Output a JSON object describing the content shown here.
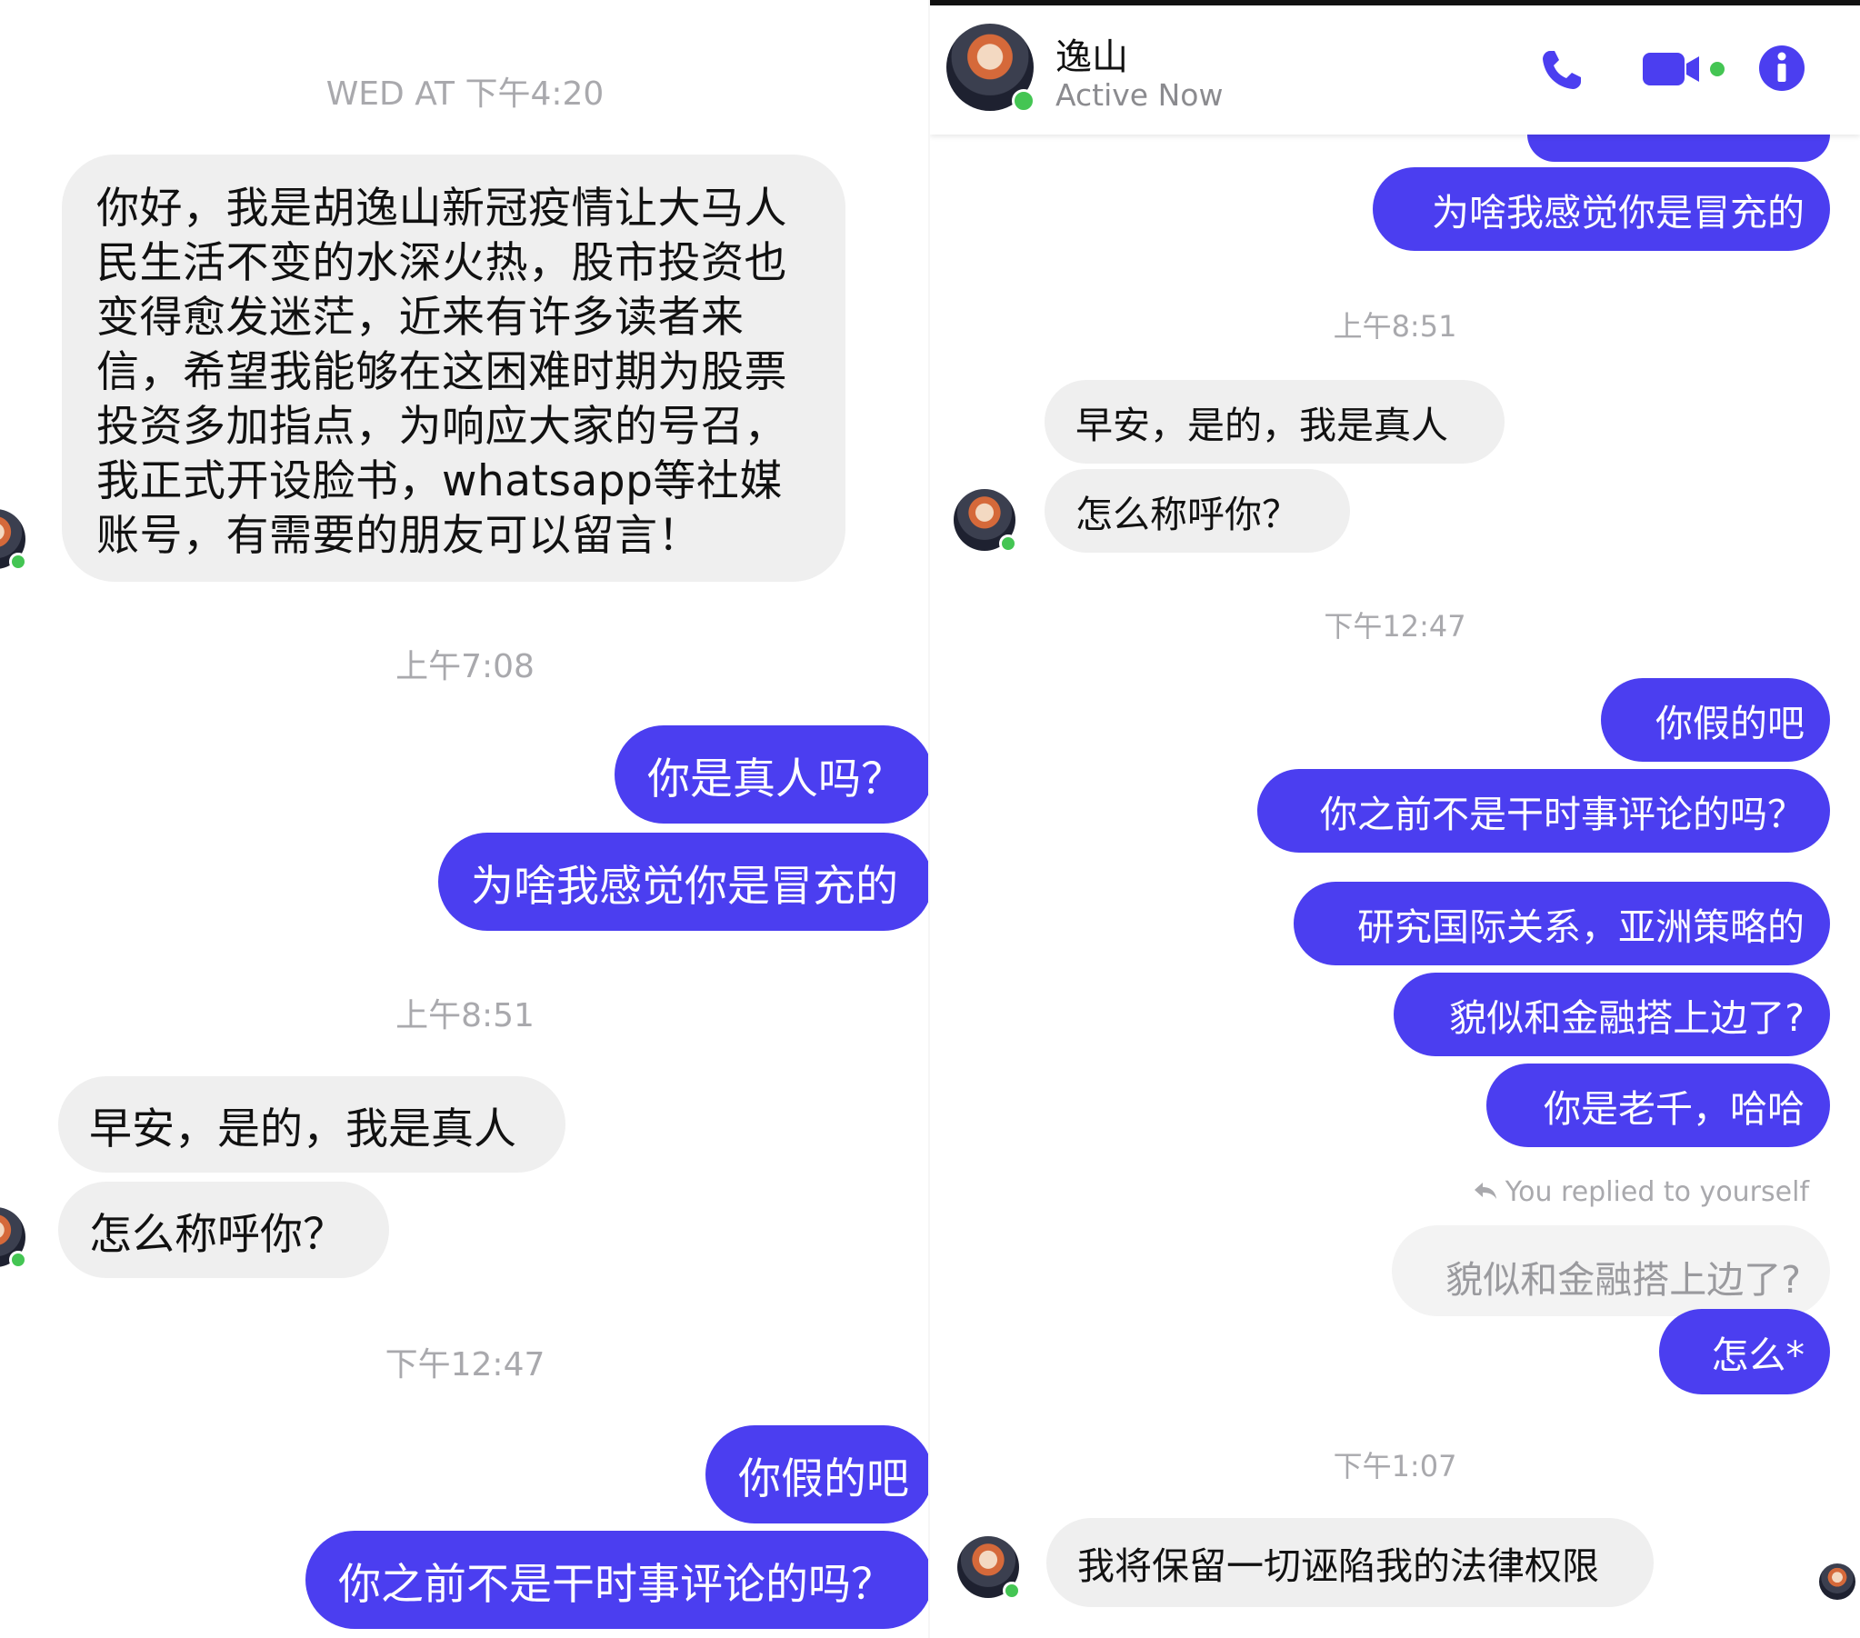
{
  "left": {
    "timestamps": {
      "t1": "WED AT 下午4:20",
      "t2": "上午7:08",
      "t3": "上午8:51",
      "t4": "下午12:47"
    },
    "messages": {
      "intro_lines": [
        "你好，我是胡逸山新冠疫情让大马人",
        "民生活不变的水深火热，股市投资也",
        "变得愈发迷茫，近来有许多读者来",
        "信，希望我能够在这困难时期为股票",
        "投资多加指点，为响应大家的号召，",
        "我正式开设脸书，whatsapp等社媒",
        "账号，有需要的朋友可以留言！"
      ],
      "out_real": "你是真人吗？",
      "out_fake_feel": "为啥我感觉你是冒充的",
      "in_morning": "早安，是的，我是真人",
      "in_name": "怎么称呼你？",
      "out_fake": "你假的吧",
      "out_commentary": "你之前不是干时事评论的吗？"
    }
  },
  "right": {
    "header": {
      "name": "逸山",
      "status": "Active Now",
      "icons": [
        "phone-icon",
        "video-call-icon",
        "info-icon"
      ],
      "accent": "#4b3ef0"
    },
    "timestamps": {
      "t1": "上午8:51",
      "t2": "下午12:47",
      "t3": "下午1:07"
    },
    "messages": {
      "out_fake_feel": "为啥我感觉你是冒充的",
      "in_morning": "早安，是的，我是真人",
      "in_name": "怎么称呼你？",
      "out_fake": "你假的吧",
      "out_commentary": "你之前不是干时事评论的吗？",
      "out_research": "研究国际关系，亚洲策略的",
      "out_finance": "貌似和金融搭上边了?",
      "out_veteran": "你是老千，哈哈",
      "reply_note": "You replied to yourself",
      "reply_quote": "貌似和金融搭上边了?",
      "out_how": "怎么*",
      "in_legal": "我将保留一切诬陷我的法律权限"
    }
  }
}
